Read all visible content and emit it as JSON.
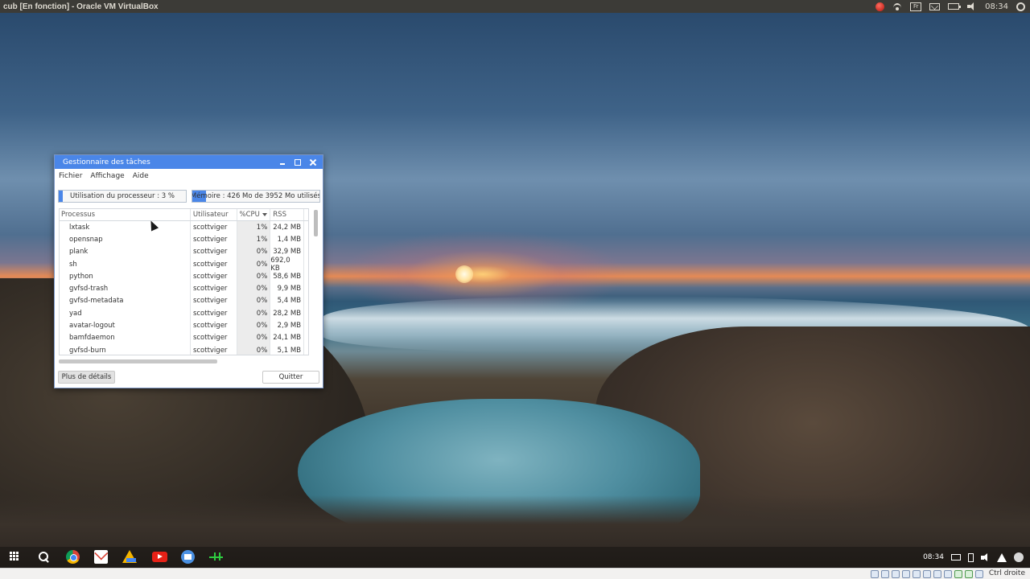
{
  "host": {
    "window_title": "cub [En fonction] - Oracle VM VirtualBox",
    "tray": {
      "language": "Fr",
      "clock": "08:34",
      "icons": [
        "record-icon",
        "wifi-icon",
        "keyboard-layout-icon",
        "mail-icon",
        "battery-icon",
        "volume-icon",
        "settings-gear-icon"
      ]
    },
    "statusbar": {
      "host_key": "Ctrl droite",
      "icons": [
        "hdd-icon",
        "optical-drive-icon",
        "audio-icon",
        "network-icon",
        "usb-icon",
        "shared-folders-icon",
        "display-icon",
        "video-capture-icon",
        "mouse-integration-icon",
        "cpu-icon",
        "arrow-icon"
      ]
    }
  },
  "taskmanager": {
    "title": "Gestionnaire des tâches",
    "menu": [
      "Fichier",
      "Affichage",
      "Aide"
    ],
    "cpu_meter": {
      "label": "Utilisation du processeur : 3 %",
      "percent": 3
    },
    "memory_meter": {
      "label": "Mémoire : 426 Mo de 3952 Mo utilisés",
      "used_mb": 426,
      "total_mb": 3952
    },
    "columns": [
      "Processus",
      "Utilisateur",
      "%CPU",
      "RSS"
    ],
    "sorted_column": "%CPU",
    "rows": [
      {
        "process": "lxtask",
        "user": "scottviger",
        "cpu": "1%",
        "rss": "24,2 MB"
      },
      {
        "process": "opensnap",
        "user": "scottviger",
        "cpu": "1%",
        "rss": "1,4 MB"
      },
      {
        "process": "plank",
        "user": "scottviger",
        "cpu": "0%",
        "rss": "32,9 MB"
      },
      {
        "process": "sh",
        "user": "scottviger",
        "cpu": "0%",
        "rss": "692,0 KB"
      },
      {
        "process": "python",
        "user": "scottviger",
        "cpu": "0%",
        "rss": "58,6 MB"
      },
      {
        "process": "gvfsd-trash",
        "user": "scottviger",
        "cpu": "0%",
        "rss": "9,9 MB"
      },
      {
        "process": "gvfsd-metadata",
        "user": "scottviger",
        "cpu": "0%",
        "rss": "5,4 MB"
      },
      {
        "process": "yad",
        "user": "scottviger",
        "cpu": "0%",
        "rss": "28,2 MB"
      },
      {
        "process": "avatar-logout",
        "user": "scottviger",
        "cpu": "0%",
        "rss": "2,9 MB"
      },
      {
        "process": "bamfdaemon",
        "user": "scottviger",
        "cpu": "0%",
        "rss": "24,1 MB"
      },
      {
        "process": "gvfsd-burn",
        "user": "scottviger",
        "cpu": "0%",
        "rss": "5,1 MB"
      }
    ],
    "details_button": "Plus de détails",
    "quit_button": "Quitter"
  },
  "shelf": {
    "apps": [
      "launcher-icon",
      "search-icon",
      "chrome-icon",
      "gmail-icon",
      "drive-icon",
      "youtube-icon",
      "files-icon",
      "task-manager-icon"
    ],
    "clock": "08:34",
    "status_icons": [
      "keyboard-icon",
      "battery-icon",
      "volume-icon",
      "wifi-icon",
      "avatar"
    ]
  }
}
